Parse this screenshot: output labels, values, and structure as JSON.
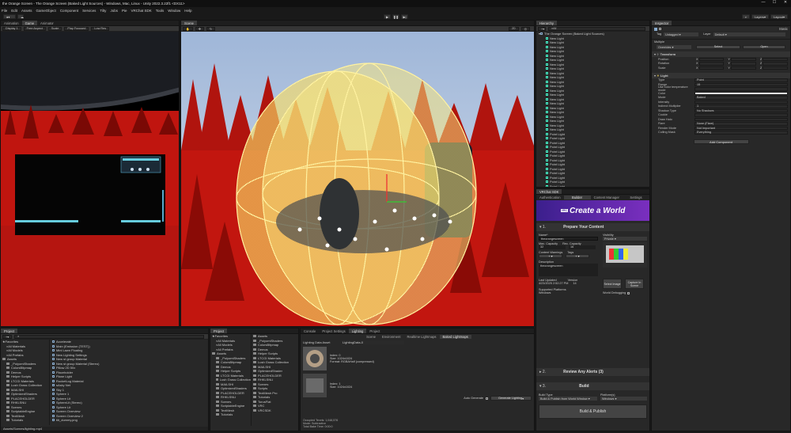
{
  "window_title": "the Orange Screen - The Orange Screen (Baked Light Sources) - Windows, Mac, Linux - Unity 2022.3.22f1 <DX11>",
  "window_controls": [
    "—",
    "☐",
    "✕"
  ],
  "menu": [
    "File",
    "Edit",
    "Assets",
    "GameObject",
    "Component",
    "Services",
    "Tilty",
    "Jobs",
    "Pie",
    "VRChat SDK",
    "Tools",
    "Window",
    "Help"
  ],
  "toolbar": {
    "right": [
      "Layers",
      "Layout"
    ]
  },
  "left_panel": {
    "tabs": [
      "Animation",
      "Game",
      "Animator"
    ],
    "sub": [
      "Display 1",
      "Free Aspect",
      "Scale",
      "Play Focused",
      "Low Res"
    ]
  },
  "scene": {
    "tab": "Scene",
    "tools": [
      "2D",
      "Persp"
    ]
  },
  "hierarchy": {
    "tab": "Hierarchy",
    "search": "All",
    "root": "The Orange Screen (Baked Light Sources)",
    "items": [
      "New Light",
      "New Light",
      "New Light",
      "New Light",
      "New Light",
      "New Light",
      "New Light",
      "New Light",
      "New Light",
      "New Light",
      "New Light",
      "New Light",
      "New Light",
      "New Light",
      "New Light",
      "New Light",
      "New Light",
      "New Light",
      "New Light",
      "New Light",
      "New Light",
      "New Light",
      "Point Light",
      "Point Light",
      "Point Light",
      "Point Light",
      "Point Light",
      "Point Light",
      "Point Light",
      "Point Light",
      "Point Light",
      "Point Light",
      "Point Light",
      "Point Light",
      "Point Light",
      "Point Light",
      "Point Light"
    ]
  },
  "inspector": {
    "tab": "Inspector",
    "static": "Static",
    "tag_label": "Tag",
    "tag": "Untagged",
    "layer_label": "Layer",
    "layer": "Default",
    "multiple": "Multiple",
    "overrides": "Overrides",
    "select": "Select",
    "open": "Open",
    "transform": {
      "title": "Transform",
      "rows": [
        [
          "Position",
          "X",
          "Y",
          "Z"
        ],
        [
          "Rotation",
          "X",
          "Y",
          "Z"
        ],
        [
          "Scale",
          "X",
          "Y",
          "Z"
        ]
      ]
    },
    "light": {
      "title": "Light",
      "rows": [
        [
          "Type",
          "Point"
        ],
        [
          "Range",
          "15"
        ],
        [
          "Use color temperature mode",
          ""
        ],
        [
          "Color",
          ""
        ],
        [
          "Mode",
          "Baked"
        ],
        [
          "Intensity",
          ""
        ],
        [
          "Indirect Multiplier",
          "1"
        ],
        [
          "Shadow Type",
          "No Shadows"
        ],
        [
          "Cookie",
          ""
        ],
        [
          "Draw Halo",
          ""
        ],
        [
          "Flare",
          "None (Flare)"
        ],
        [
          "Render Mode",
          "Not Important"
        ],
        [
          "Culling Mask",
          "Everything"
        ]
      ]
    },
    "add_component": "Add Component"
  },
  "vrc": {
    "tabs": [
      "VRChat SDK",
      "Builder",
      "Content Manager",
      "Settings"
    ],
    "top_tabs": [
      "Authentication",
      "Builder",
      "Content Manager",
      "Settings"
    ],
    "banner": "Create a World",
    "banner_tag": "VRC",
    "s1_num": "1.",
    "s1_title": "Prepare Your Content",
    "name_label": "Name*",
    "name_val": "theorangescreen",
    "max_cap": "Max. Capacity",
    "rec_cap": "Rec. Capacity",
    "cap_val": "32",
    "rec_val": "16",
    "content_warn": "Content Warnings",
    "tags": "Tags",
    "vis_label": "Visibility",
    "vis_val": "Private",
    "desc_label": "Description",
    "desc_val": "theorangescreen",
    "last_updated": "Last Updated",
    "version": "Version",
    "date": "4/23/2025 2:52:27 PM",
    "version_val": "14",
    "select_image": "Select Image",
    "capture": "Capture In Scene",
    "world_debug": "World Debugging",
    "platforms": "Supported Platforms",
    "platform_val": "Windows",
    "s2_num": "2.",
    "s2_title": "Review Any Alerts (3)",
    "s3_num": "3.",
    "s3_title": "Build",
    "build_type": "Build Type",
    "build_type_val": "Build & Publish from World Window",
    "platform_label": "Platform(s)",
    "platform_sel": "Windows",
    "build_publish": "Build & Publish"
  },
  "project": {
    "tab": "Project",
    "favorites": [
      "Favorites",
      "All Materials",
      "All Models",
      "All Prefabs"
    ],
    "assets_tree": [
      "Assets",
      "_PoiyomiShaders",
      "ColorsBitpmap",
      "Demos",
      "Helper Scripts",
      "LTCGI Materials",
      "Lush Grass Collection",
      "MAILSHI",
      "OptimizedShaders",
      "PLACEHOLDER",
      "RHKLSNU",
      "Scenes",
      "ScriptableEngine",
      "TextMesh",
      "Tutorials"
    ],
    "files": [
      "Accelerate",
      "Main (Emission (TEST))",
      "Mini Lawn Floating",
      "New Lighting Settings",
      "New st group Material",
      "New st group Material (Stereo)",
      "Pillow 2D 50x",
      "Placeholder",
      "Plane Light",
      "RocketLog Material",
      "sAsky Net",
      "Sky 1",
      "Sphere 1",
      "Sphere Lit",
      "SphereLit (Stereo)",
      "Sphere Lit",
      "Screen Overview",
      "Screen Overview 2",
      "tilt_dummy.png"
    ],
    "status": "Assets/Scenes/lighting.mp4"
  },
  "project2": {
    "tab": "Project",
    "favorites": [
      "Favorites",
      "All Materials",
      "All Models",
      "All Prefabs"
    ],
    "assets_tree": [
      "Assets",
      "_PoiyomiShaders",
      "ColorsBitpmap",
      "Demos",
      "Helper Scripts",
      "LTCGI Materials",
      "Lush Grass Collection",
      "MAILSHI",
      "OptimizedShaders",
      "PLACEHOLDER",
      "RHKLSNU",
      "Scenes",
      "ScriptableEngine",
      "TextMesh",
      "Tutorials"
    ],
    "files": [
      "Assets",
      "_PoiyomiShaders",
      "ColorsBitpmap",
      "Demos",
      "Helper Scripts",
      "LTCGI Materials",
      "Lush Grass Collection",
      "MAILSHI",
      "OptimizedShader",
      "PLACEHOLDER",
      "RHKLSNU",
      "Scenes",
      "Scripts",
      "TextMesh Pro",
      "Tutorials",
      "TorusFlat",
      "VRC",
      "VRCSDK"
    ]
  },
  "lighting": {
    "tabs": [
      "Console",
      "Project Settings",
      "Lighting",
      "Project"
    ],
    "subtabs": [
      "Scene",
      "Environment",
      "Realtime Lightmaps",
      "Baked Lightmaps"
    ],
    "asset_label": "Lighting Data Asset",
    "asset_val": "LightingData-0",
    "map0": "Index: 0",
    "map0_size": "Size: 1024x1024",
    "map0_fmt": "Format: RGBAHalf (compressed)",
    "map1": "Index: 1",
    "map1_size": "Size: 1024x1024",
    "auto_gen": "Auto Generate",
    "gen_btn": "Generate Lighting",
    "stats": [
      "Occupied Texels: 1,048,576",
      "Mode: Subtractive",
      "Total Bake Time: 0:00:0"
    ]
  },
  "colors": {
    "accent": "#4a90e2",
    "red": "#c41414",
    "yellow": "#ffe23a",
    "banner1": "#3b1f8c",
    "banner2": "#7a2fbf"
  }
}
